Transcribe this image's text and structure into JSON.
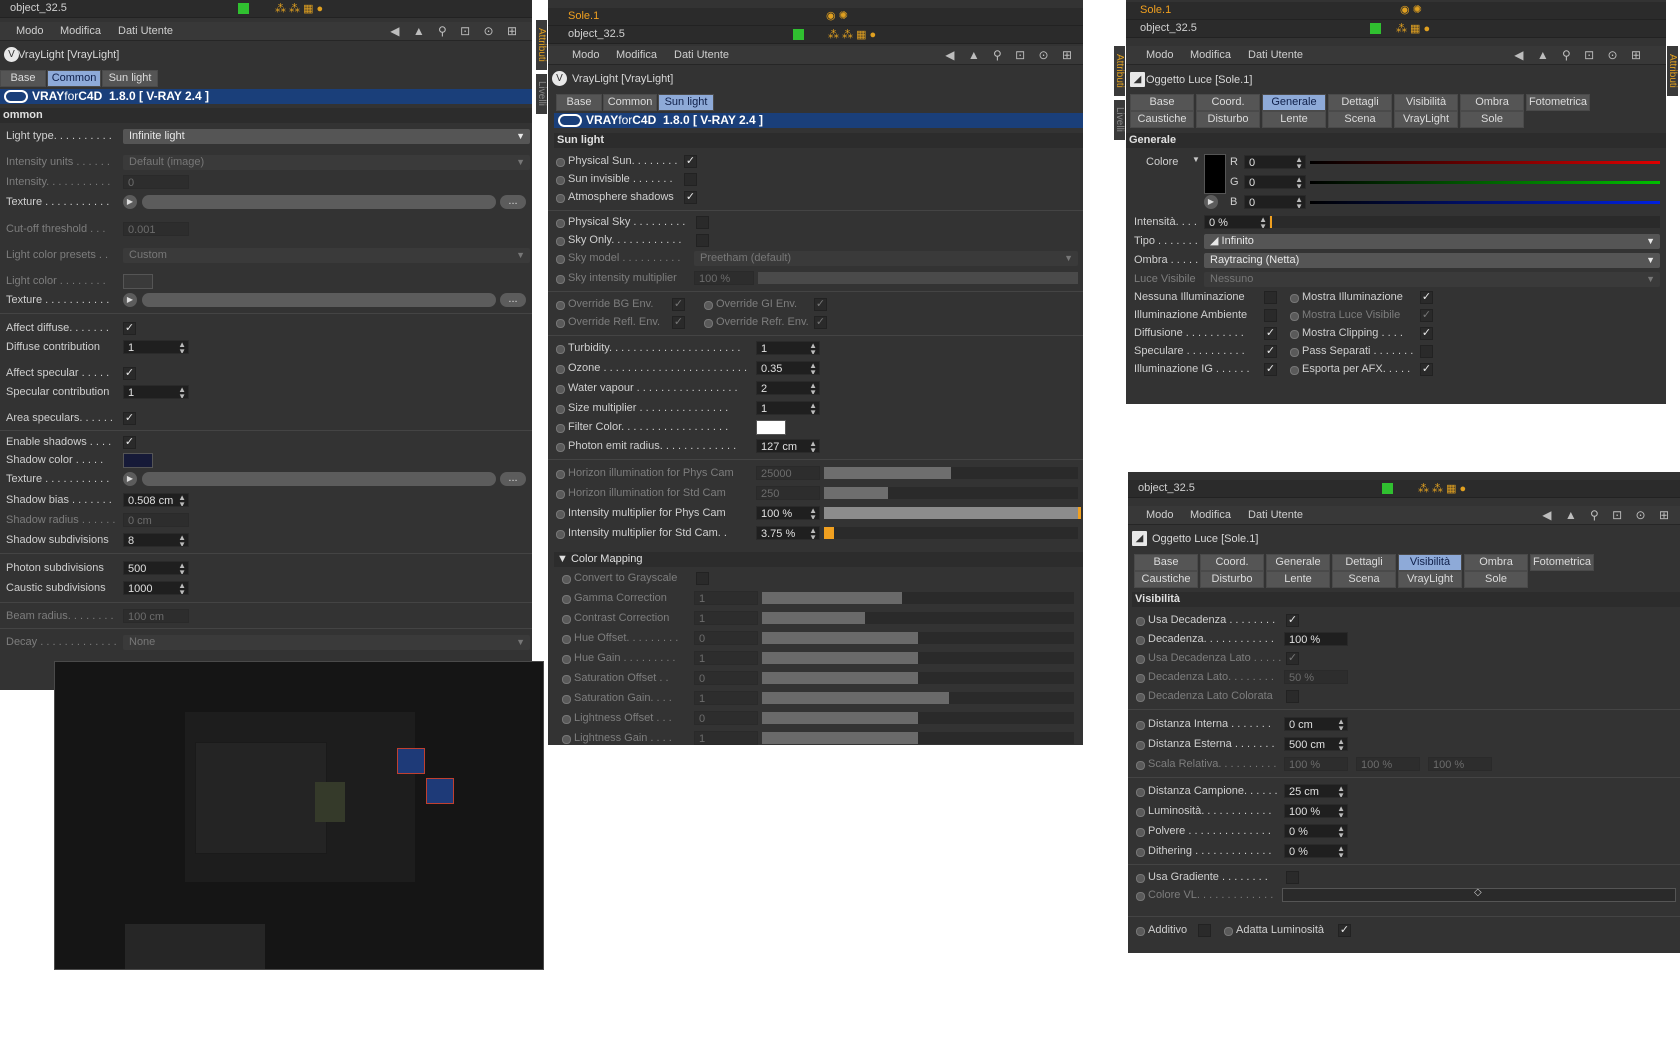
{
  "menu": {
    "modo": "Modo",
    "modifica": "Modifica",
    "dati": "Dati Utente"
  },
  "nav_icons": "◀ ▲ ⚲ ⊡ ⊙ ⊞",
  "objects": {
    "object": "object_32.5",
    "sole": "Sole.1"
  },
  "left": {
    "title": "VrayLight [VrayLight]",
    "tabs": [
      "Base",
      "Common",
      "Sun light"
    ],
    "banner": {
      "vray": "VRAY",
      "for": "for",
      "c4d": "C4D",
      "version": "1.8.0  [ V-RAY 2.4 ]"
    },
    "section": "ommon",
    "light_type": {
      "label": "Light type. . . . . . . . . .",
      "value": "Infinite light"
    },
    "intensity_units": {
      "label": "Intensity units . . . . . .",
      "value": "Default (image)"
    },
    "intensity": {
      "label": "Intensity. . . . . . . . . . .",
      "value": "0"
    },
    "texture": "Texture . . . . . . . . . . .",
    "cutoff": {
      "label": "Cut-off threshold . . .",
      "value": "0.001"
    },
    "presets": {
      "label": "Light color presets . .",
      "value": "Custom"
    },
    "light_color": "Light color . . . . . . . .",
    "affect_diffuse": {
      "label": "Affect diffuse. . . . . . .",
      "check": "✓"
    },
    "diffuse_contrib": {
      "label": "Diffuse contribution",
      "value": "1"
    },
    "affect_specular": {
      "label": "Affect specular . . . . .",
      "check": "✓"
    },
    "specular_contrib": {
      "label": "Specular contribution",
      "value": "1"
    },
    "area_speculars": {
      "label": "Area speculars. . . . . .",
      "check": "✓"
    },
    "enable_shadows": {
      "label": "Enable shadows . . . .",
      "check": "✓"
    },
    "shadow_color": "Shadow color . . . . .",
    "shadow_bias": {
      "label": "Shadow bias . . . . . . .",
      "value": "0.508 cm"
    },
    "shadow_radius": {
      "label": "Shadow radius . . . . . .",
      "value": "0 cm"
    },
    "shadow_subdiv": {
      "label": "Shadow subdivisions",
      "value": "8"
    },
    "photon_subdiv": {
      "label": "Photon subdivisions",
      "value": "500"
    },
    "caustic_subdiv": {
      "label": "Caustic subdivisions",
      "value": "1000"
    },
    "beam_radius": {
      "label": "Beam radius. . . . . . . .",
      "value": "100 cm"
    },
    "decay": {
      "label": "Decay . . . . . . . . . . . . .",
      "value": "None"
    },
    "dots": "...",
    "side_tab_attr": "Attributi",
    "side_tab_liv": "Livelli"
  },
  "mid": {
    "title": "VrayLight [VrayLight]",
    "tabs": [
      "Base",
      "Common",
      "Sun light"
    ],
    "section": "Sun light",
    "physical_sun": {
      "label": "Physical Sun. . . . . . . .",
      "check": "✓"
    },
    "sun_invisible": {
      "label": "Sun invisible . . . . . . ."
    },
    "atmo_shadows": {
      "label": "Atmosphere shadows",
      "check": "✓"
    },
    "physical_sky": {
      "label": "Physical Sky . . . . . . . . ."
    },
    "sky_only": {
      "label": "Sky Only. . . . . . . . . . . ."
    },
    "sky_model": {
      "label": "Sky model . . . . . . . . . .",
      "value": "Preetham (default)"
    },
    "sky_mult": {
      "label": "Sky intensity multiplier",
      "value": "100 %"
    },
    "override_bg": {
      "label": "Override BG Env.",
      "check": "✓"
    },
    "override_gi": {
      "label": "Override GI Env.",
      "check": "✓"
    },
    "override_refl": {
      "label": "Override Refl. Env.",
      "check": "✓"
    },
    "override_refr": {
      "label": "Override Refr. Env.",
      "check": "✓"
    },
    "turbidity": {
      "label": "Turbidity. . . . . . . . . . . . . . . . . . . . . .",
      "value": "1"
    },
    "ozone": {
      "label": "Ozone . . . . . . . . . . . . . . . . . . . . . . . .",
      "value": "0.35"
    },
    "water_vapour": {
      "label": "Water vapour . . . . . . . . . . . . . . . . .",
      "value": "2"
    },
    "size_mult": {
      "label": "Size multiplier . . . . . . . . . . . . . . .",
      "value": "1"
    },
    "filter_color": {
      "label": "Filter Color. . . . . . . . . . . . . . . . . ."
    },
    "photon_radius": {
      "label": "Photon emit radius. . . . . . . . . . . . .",
      "value": "127 cm"
    },
    "horizon_phys": {
      "label": "Horizon illumination for Phys Cam",
      "value": "25000",
      "level": 0.5
    },
    "horizon_std": {
      "label": "Horizon illumination for Std Cam",
      "value": "250",
      "level": 0.25
    },
    "int_phys": {
      "label": "Intensity multiplier for Phys Cam",
      "value": "100 %",
      "level": 1.0
    },
    "int_std": {
      "label": "Intensity multiplier for Std Cam. .",
      "value": "3.75 %",
      "level": 0.0375
    },
    "color_mapping": "Color Mapping",
    "cm_rows": [
      {
        "label": "Convert to Grayscale",
        "value": "",
        "level": -1
      },
      {
        "label": "Gamma Correction",
        "value": "1",
        "level": 0.45
      },
      {
        "label": "Contrast Correction",
        "value": "1",
        "level": 0.33
      },
      {
        "label": "Hue Offset. . . . . . . . .",
        "value": "0",
        "level": 0.5
      },
      {
        "label": "Hue Gain . . . . . . . . .",
        "value": "1",
        "level": 0.5
      },
      {
        "label": "Saturation Offset . .",
        "value": "0",
        "level": 0.5
      },
      {
        "label": "Saturation Gain. . . .",
        "value": "1",
        "level": 0.6
      },
      {
        "label": "Lightness Offset . . .",
        "value": "0",
        "level": 0.5
      },
      {
        "label": "Lightness Gain . . . .",
        "value": "1",
        "level": 0.5
      }
    ]
  },
  "right": {
    "title": "Oggetto Luce [Sole.1]",
    "tabs1": [
      "Base",
      "Coord.",
      "Generale",
      "Dettagli",
      "Visibilità",
      "Ombra",
      "Fotometrica"
    ],
    "tabs2": [
      "Caustiche",
      "Disturbo",
      "Lente",
      "Scena",
      "VrayLight",
      "Sole"
    ],
    "section": "Generale",
    "colore": "Colore",
    "r": {
      "label": "R",
      "value": "0"
    },
    "g": {
      "label": "G",
      "value": "0"
    },
    "b": {
      "label": "B",
      "value": "0"
    },
    "intensita": {
      "label": "Intensità. . . .",
      "value": "0 %"
    },
    "tipo": {
      "label": "Tipo . . . . . . .",
      "value": "Infinito"
    },
    "ombra": {
      "label": "Ombra . . . . .",
      "value": "Raytracing (Netta)"
    },
    "luce_visibile": {
      "label": "Luce Visibile",
      "value": "Nessuno"
    },
    "checks_left": [
      {
        "label": "Nessuna Illuminazione",
        "check": ""
      },
      {
        "label": "Illuminazione Ambiente",
        "check": ""
      },
      {
        "label": "Diffusione . . . . . . . . . .",
        "check": "✓"
      },
      {
        "label": "Speculare . . . . . . . . . .",
        "check": "✓"
      },
      {
        "label": "Illuminazione IG . . . . . .",
        "check": "✓"
      }
    ],
    "checks_right": [
      {
        "label": "Mostra Illuminazione",
        "check": "✓"
      },
      {
        "label": "Mostra Luce Visibile",
        "check": "✓"
      },
      {
        "label": "Mostra Clipping . . . .",
        "check": "✓"
      },
      {
        "label": "Pass Separati . . . . . . .",
        "check": ""
      },
      {
        "label": "Esporta per AFX. . . . .",
        "check": "✓"
      }
    ]
  },
  "bottom": {
    "title": "Oggetto Luce [Sole.1]",
    "section": "Visibilità",
    "rows": [
      {
        "label": "Usa Decadenza . . . . . . . .",
        "check": "✓"
      },
      {
        "label": "Decadenza. . . . . . . . . . . .",
        "value": "100 %"
      },
      {
        "label": "Usa Decadenza Lato . . . . .",
        "check": "✓"
      },
      {
        "label": "Decadenza Lato. . . . . . . .",
        "value": "50 %"
      },
      {
        "label": "Decadenza Lato Colorata",
        "check": ""
      }
    ],
    "dist_int": {
      "label": "Distanza Interna . . . . . . .",
      "value": "0 cm"
    },
    "dist_est": {
      "label": "Distanza Esterna . . . . . . .",
      "value": "500 cm"
    },
    "scala": {
      "label": "Scala Relativa. . . . . . . . . .",
      "values": [
        "100 %",
        "100 %",
        "100 %"
      ]
    },
    "dist_camp": {
      "label": "Distanza Campione. . . . . .",
      "value": "25 cm"
    },
    "lumin": {
      "label": "Luminosità. . . . . . . . . . . .",
      "value": "100 %"
    },
    "polvere": {
      "label": "Polvere . . . . . . . . . . . . . .",
      "value": "0 %"
    },
    "dither": {
      "label": "Dithering . . . . . . . . . . . . .",
      "value": "0 %"
    },
    "usa_grad": {
      "label": "Usa Gradiente . . . . . . . .",
      "check": ""
    },
    "colore_vl": {
      "label": "Colore VL. . . . . . . . . . . . ."
    },
    "additivo": {
      "label": "Additivo"
    },
    "adatta": {
      "label": "Adatta Luminosità",
      "check": "✓"
    }
  },
  "colors": {
    "accent": "#f0a020",
    "tab_active": "#8eaad8",
    "banner": "#1a3f7a",
    "panel": "#333333"
  }
}
